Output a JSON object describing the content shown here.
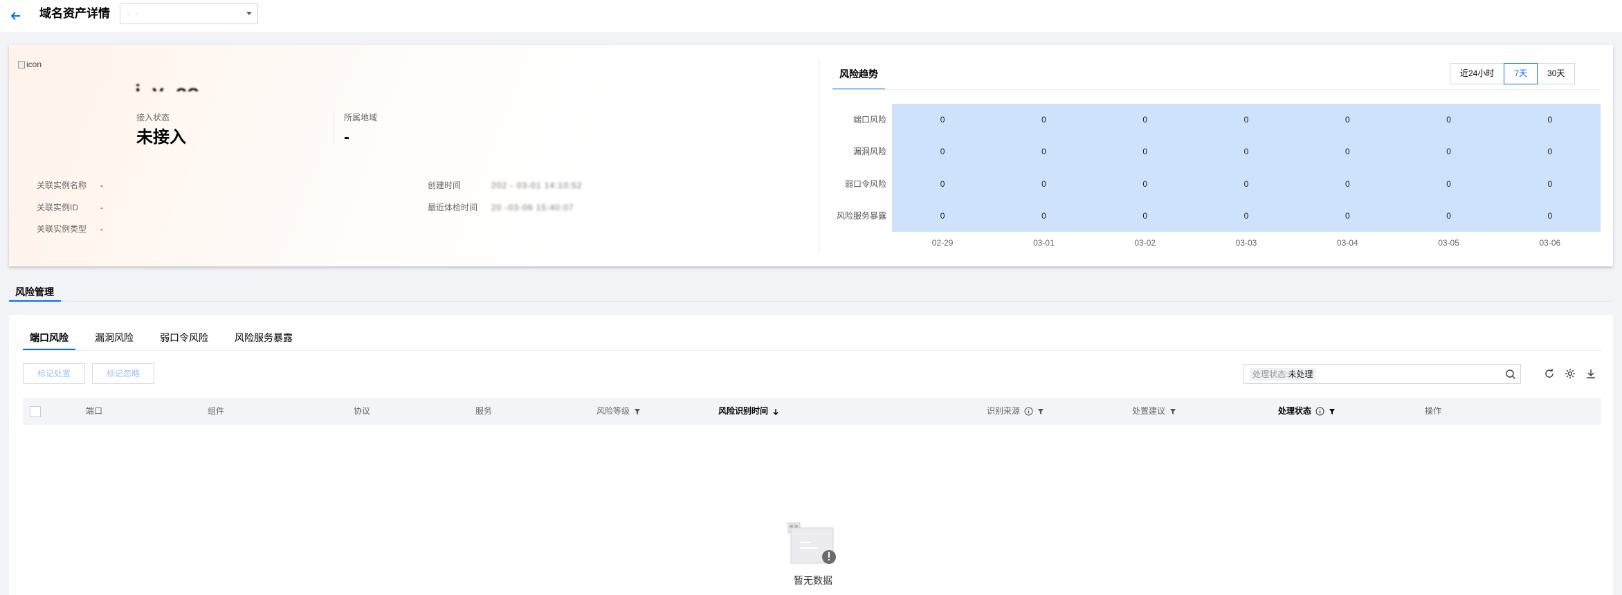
{
  "header": {
    "title": "域名资产详情",
    "domain_select_value": "· ·"
  },
  "asset": {
    "broken_image_alt": "icon",
    "domain_name": "i.   y  .co..",
    "stats": [
      {
        "label": "接入状态",
        "value": "未接入"
      },
      {
        "label": "所属地域",
        "value": "-"
      }
    ],
    "info_left": [
      {
        "label": "关联实例名称",
        "value": "-"
      },
      {
        "label": "关联实例ID",
        "value": "-"
      },
      {
        "label": "关联实例类型",
        "value": "-"
      }
    ],
    "info_right": [
      {
        "label": "创建时间",
        "value": "202 - 03-01 14:10:52"
      },
      {
        "label": "最近体检时间",
        "value": "20   -03-06 15:40:07"
      }
    ]
  },
  "trend": {
    "tab_label": "风险趋势",
    "ranges": [
      {
        "label": "近24小时",
        "active": false
      },
      {
        "label": "7天",
        "active": true
      },
      {
        "label": "30天",
        "active": false
      }
    ],
    "accent_color": "#006eff",
    "cell_color": "#cfe2fb"
  },
  "chart_data": {
    "type": "heatmap",
    "x": [
      "02-29",
      "03-01",
      "03-02",
      "03-03",
      "03-04",
      "03-05",
      "03-06"
    ],
    "y": [
      "端口风险",
      "漏洞风险",
      "弱口令风险",
      "风险服务暴露"
    ],
    "values": [
      [
        0,
        0,
        0,
        0,
        0,
        0,
        0
      ],
      [
        0,
        0,
        0,
        0,
        0,
        0,
        0
      ],
      [
        0,
        0,
        0,
        0,
        0,
        0,
        0
      ],
      [
        0,
        0,
        0,
        0,
        0,
        0,
        0
      ]
    ]
  },
  "risk_management": {
    "title": "风险管理",
    "tabs": [
      {
        "label": "端口风险",
        "active": true
      },
      {
        "label": "漏洞风险",
        "active": false
      },
      {
        "label": "弱口令风险",
        "active": false
      },
      {
        "label": "风险服务暴露",
        "active": false
      }
    ],
    "buttons": {
      "mark_handled": "标记处置",
      "mark_ignored": "标记忽略"
    },
    "search": {
      "filter_key": "处理状态:",
      "filter_value": "未处理"
    },
    "columns": [
      {
        "label": "端口"
      },
      {
        "label": "组件"
      },
      {
        "label": "协议"
      },
      {
        "label": "服务"
      },
      {
        "label": "风险等级"
      },
      {
        "label": "风险识别时间"
      },
      {
        "label": "识别来源"
      },
      {
        "label": "处置建议"
      },
      {
        "label": "处理状态"
      },
      {
        "label": "操作"
      }
    ],
    "empty_text": "暂无数据"
  }
}
